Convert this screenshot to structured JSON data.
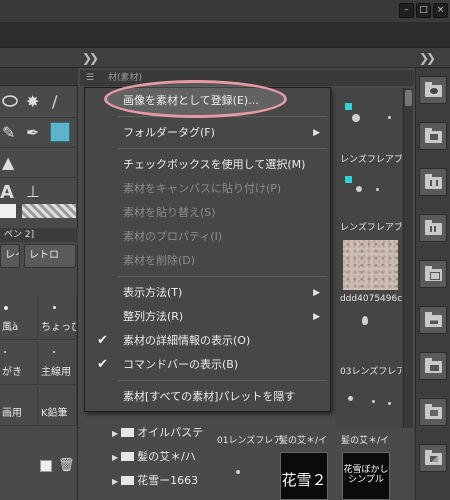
{
  "window": {
    "buttons": [
      {
        "name": "minimize",
        "glyph": "–"
      },
      {
        "name": "maximize",
        "glyph": "□"
      },
      {
        "name": "close",
        "glyph": "×"
      }
    ]
  },
  "material_panel": {
    "header_partial": "材(素材)"
  },
  "left_panel": {
    "tab_label": "ペン 2]",
    "buttons": [
      "レイ",
      "レトロ"
    ],
    "brushes": [
      "風à",
      "ちょっぴ!",
      "がき",
      "主線用",
      "画用",
      "K鉛筆"
    ]
  },
  "materials": {
    "labels": [
      "レンズフレアブ",
      "レンズフレアブ",
      "ddd4075496c",
      "03レンズフレア"
    ]
  },
  "bottom": {
    "labels": [
      "01レンズフレア",
      "髪の艾＊/イ",
      "髪の艾＊/イ"
    ],
    "thumb1_text": "花雪２",
    "thumb2_lines": [
      "花雪ぼかし",
      "シンプル"
    ]
  },
  "tree": {
    "items": [
      "オイルパステ",
      "髪の艾＊/ハ",
      "花雪ー1663"
    ]
  },
  "context_menu": {
    "items": [
      {
        "label": "画像を素材として登録(E)...",
        "enabled": true,
        "highlighted": true
      },
      {
        "label": "フォルダータグ(F)",
        "enabled": true,
        "submenu": true
      },
      {
        "label": "チェックボックスを使用して選択(M)",
        "enabled": true
      },
      {
        "label": "素材をキャンバスに貼り付け(P)",
        "enabled": false
      },
      {
        "label": "素材を貼り替え(S)",
        "enabled": false
      },
      {
        "label": "素材のプロパティ(I)",
        "enabled": false
      },
      {
        "label": "素材を削除(D)",
        "enabled": false
      },
      {
        "label": "表示方法(T)",
        "enabled": true,
        "submenu": true
      },
      {
        "label": "整列方法(R)",
        "enabled": true,
        "submenu": true
      },
      {
        "label": "素材の詳細情報の表示(O)",
        "enabled": true,
        "checked": true
      },
      {
        "label": "コマンドバーの表示(B)",
        "enabled": true,
        "checked": true
      },
      {
        "label": "素材[すべての素材]パレットを隠す",
        "enabled": true
      }
    ],
    "submenu_glyph": "▶",
    "check_glyph": "✔"
  }
}
